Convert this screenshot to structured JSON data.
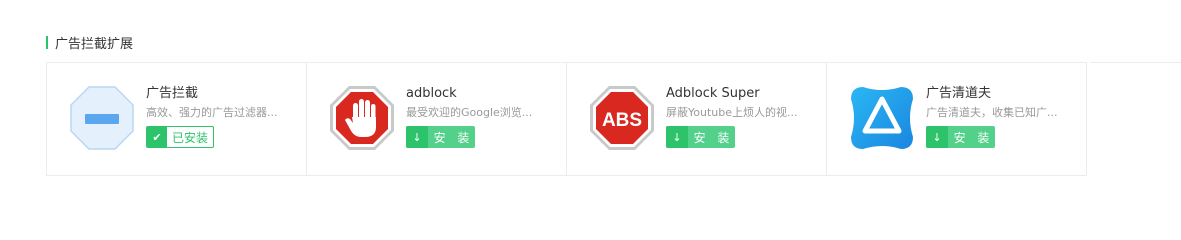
{
  "section": {
    "title": "广告拦截扩展"
  },
  "extensions": [
    {
      "name": "广告拦截",
      "desc": "高效、强力的广告过滤器...",
      "button": "已安装",
      "icon": "octagon-minus-icon",
      "installed": true
    },
    {
      "name": "adblock",
      "desc": "最受欢迎的Google浏览...",
      "button": "安 装",
      "icon": "stop-hand-icon",
      "installed": false
    },
    {
      "name": "Adblock Super",
      "desc": "屏蔽Youtube上烦人的视...",
      "button": "安 装",
      "icon": "abs-octagon-icon",
      "installed": false
    },
    {
      "name": "广告清道夫",
      "desc": "广告清道夫，收集已知广...",
      "button": "安 装",
      "icon": "triangle-logo-icon",
      "installed": false
    }
  ],
  "colors": {
    "accent": "#2cc36b",
    "install_bg": "#53d08a",
    "stop_red": "#d8281f",
    "logo_blue": "#1e9be8"
  }
}
